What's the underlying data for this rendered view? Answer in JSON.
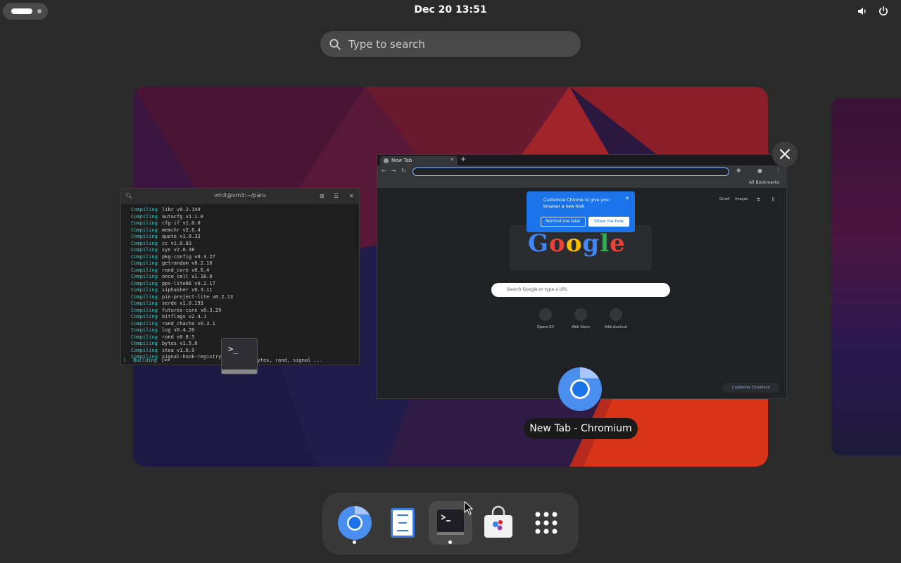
{
  "topbar": {
    "clock": "Dec 20  13:51",
    "icons": [
      "volume-icon",
      "power-icon"
    ]
  },
  "search": {
    "placeholder": "Type to search"
  },
  "terminal": {
    "title": "vm3@vm3:~/paru",
    "lines": [
      {
        "kw": "Compiling",
        "text": "libc v0.2.149"
      },
      {
        "kw": "Compiling",
        "text": "autocfg v1.1.0"
      },
      {
        "kw": "Compiling",
        "text": "cfg-if v1.0.0"
      },
      {
        "kw": "Compiling",
        "text": "memchr v2.6.4"
      },
      {
        "kw": "Compiling",
        "text": "quote v1.0.33"
      },
      {
        "kw": "Compiling",
        "text": "cc v1.0.83"
      },
      {
        "kw": "Compiling",
        "text": "syn v2.0.38"
      },
      {
        "kw": "Compiling",
        "text": "pkg-config v0.3.27"
      },
      {
        "kw": "Compiling",
        "text": "getrandom v0.2.10"
      },
      {
        "kw": "Compiling",
        "text": "rand_core v0.6.4"
      },
      {
        "kw": "Compiling",
        "text": "once_cell v1.18.0"
      },
      {
        "kw": "Compiling",
        "text": "ppv-lite86 v0.2.17"
      },
      {
        "kw": "Compiling",
        "text": "siphasher v0.3.11"
      },
      {
        "kw": "Compiling",
        "text": "pin-project-lite v0.2.13"
      },
      {
        "kw": "Compiling",
        "text": "serde v1.0.193"
      },
      {
        "kw": "Compiling",
        "text": "futures-core v0.3.29"
      },
      {
        "kw": "Compiling",
        "text": "bitflags v2.4.1"
      },
      {
        "kw": "Compiling",
        "text": "rand_chacha v0.3.1"
      },
      {
        "kw": "Compiling",
        "text": "log v0.4.20"
      },
      {
        "kw": "Compiling",
        "text": "rand v0.8.5"
      },
      {
        "kw": "Compiling",
        "text": "bytes v1.5.0"
      },
      {
        "kw": "Compiling",
        "text": "itoa v1.0.9"
      },
      {
        "kw": "Compiling",
        "text": "signal-hook-registry"
      }
    ],
    "last_kw": "Building",
    "last_text": "[=>",
    "last_tail": "8: syn, bytes, rand, signal ..."
  },
  "chrome_thumb": {
    "tab_title": "New Tab",
    "bookmarks_label": "All Bookmarks",
    "link_gmail": "Gmail",
    "link_images": "Images",
    "callout_text": "Customize Chrome to give your browser a new look",
    "callout_later": "Remind me later",
    "callout_show": "Show me how",
    "doodle": "Google",
    "search_placeholder": "Search Google or type a URL",
    "shortcuts": [
      "Opera GX",
      "Web Store",
      "Add shortcut"
    ],
    "customize": "Customize Chromium"
  },
  "window_label": "New Tab - Chromium",
  "dock": {
    "apps": [
      "chromium-icon",
      "text-editor-icon",
      "terminal-icon",
      "software-store-icon",
      "app-grid-icon"
    ],
    "active_index": 2
  },
  "colors": {
    "accent": "#1a73e8",
    "term_keyword": "#3ec6c6"
  }
}
